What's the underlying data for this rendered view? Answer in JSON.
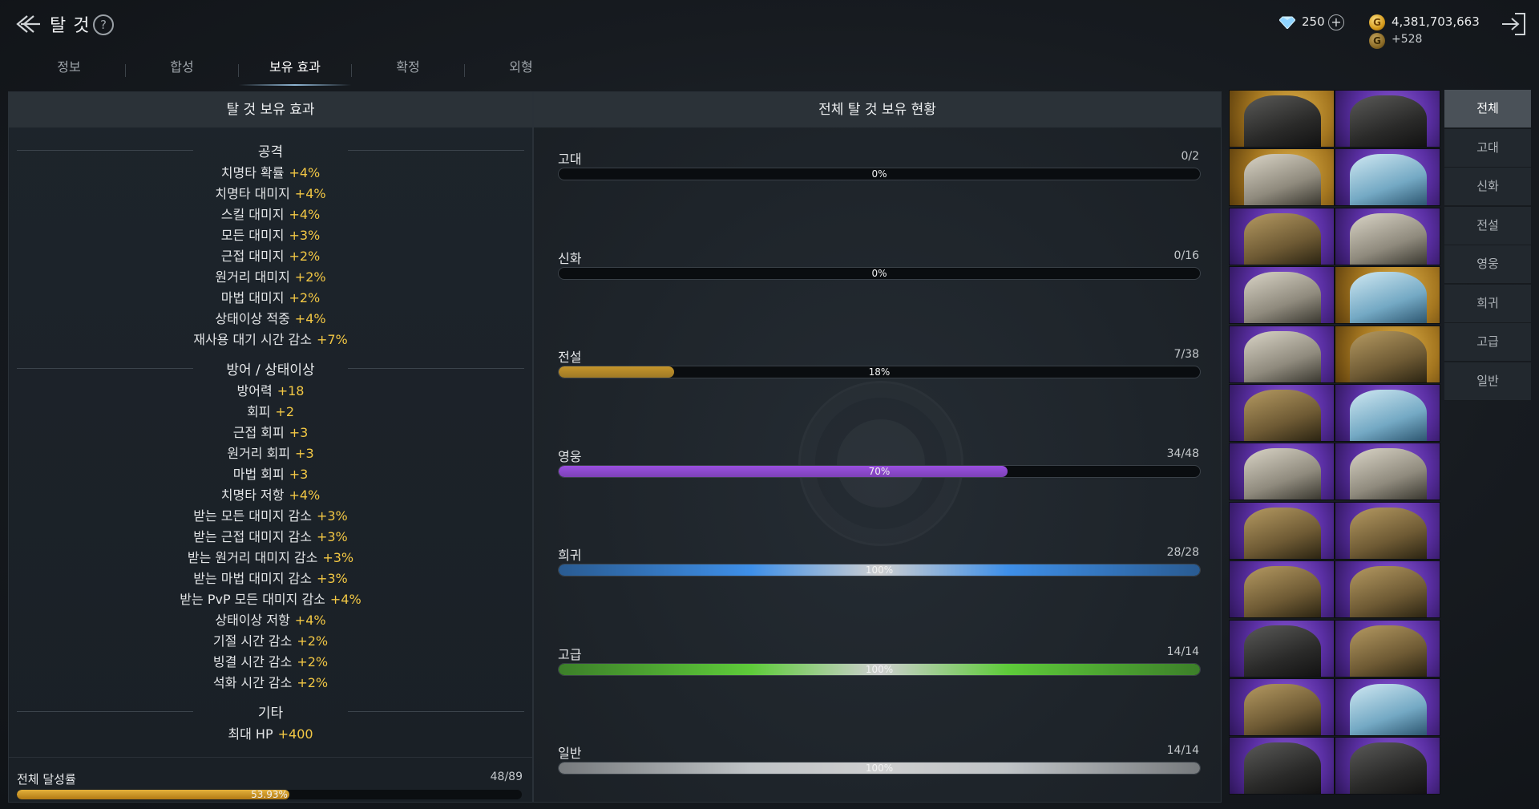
{
  "header": {
    "title": "탈 것",
    "help_icon": "?"
  },
  "currency": {
    "gems": "250",
    "gold": "4,381,703,663",
    "gold_income": "+528",
    "gold_symbol": "G"
  },
  "tabs": [
    {
      "label": "정보"
    },
    {
      "label": "합성"
    },
    {
      "label": "보유 효과"
    },
    {
      "label": "확정"
    },
    {
      "label": "외형"
    }
  ],
  "active_tab": "보유 효과",
  "left_panel": {
    "title": "탈 것 보유 효과",
    "sections": [
      {
        "title": "공격",
        "stats": [
          {
            "name": "치명타 확률",
            "value": "+4%"
          },
          {
            "name": "치명타 대미지",
            "value": "+4%"
          },
          {
            "name": "스킬 대미지",
            "value": "+4%"
          },
          {
            "name": "모든 대미지",
            "value": "+3%"
          },
          {
            "name": "근접 대미지",
            "value": "+2%"
          },
          {
            "name": "원거리 대미지",
            "value": "+2%"
          },
          {
            "name": "마법 대미지",
            "value": "+2%"
          },
          {
            "name": "상태이상 적중",
            "value": "+4%"
          },
          {
            "name": "재사용 대기 시간 감소",
            "value": "+7%"
          }
        ]
      },
      {
        "title": "방어 / 상태이상",
        "stats": [
          {
            "name": "방어력",
            "value": "+18"
          },
          {
            "name": "회피",
            "value": "+2"
          },
          {
            "name": "근접 회피",
            "value": "+3"
          },
          {
            "name": "원거리 회피",
            "value": "+3"
          },
          {
            "name": "마법 회피",
            "value": "+3"
          },
          {
            "name": "치명타 저항",
            "value": "+4%"
          },
          {
            "name": "받는 모든 대미지 감소",
            "value": "+3%"
          },
          {
            "name": "받는 근접 대미지 감소",
            "value": "+3%"
          },
          {
            "name": "받는 원거리 대미지 감소",
            "value": "+3%"
          },
          {
            "name": "받는 마법 대미지 감소",
            "value": "+3%"
          },
          {
            "name": "받는 PvP 모든 대미지 감소",
            "value": "+4%"
          },
          {
            "name": "상태이상 저항",
            "value": "+4%"
          },
          {
            "name": "기절 시간 감소",
            "value": "+2%"
          },
          {
            "name": "빙결 시간 감소",
            "value": "+2%"
          },
          {
            "name": "석화 시간 감소",
            "value": "+2%"
          }
        ]
      },
      {
        "title": "기타",
        "stats": [
          {
            "name": "최대 HP",
            "value": "+400"
          }
        ]
      }
    ],
    "total": {
      "label": "전체 달성률",
      "count": "48/89",
      "percent_text": "53.93%",
      "fraction": 0.5393
    }
  },
  "middle_panel": {
    "title": "전체 탈 것 보유 현황",
    "grades": [
      {
        "name": "고대",
        "count": "0/2",
        "percent_text": "0%",
        "fraction": 0.0,
        "color": "#c9a13a"
      },
      {
        "name": "신화",
        "count": "0/16",
        "percent_text": "0%",
        "fraction": 0.0,
        "color": "#d14848"
      },
      {
        "name": "전설",
        "count": "7/38",
        "percent_text": "18%",
        "fraction": 0.18,
        "color": "#c4952b"
      },
      {
        "name": "영웅",
        "count": "34/48",
        "percent_text": "70%",
        "fraction": 0.7,
        "color": "#9a4fe0"
      },
      {
        "name": "희귀",
        "count": "28/28",
        "percent_text": "100%",
        "fraction": 1.0,
        "color": "#3e8fe8"
      },
      {
        "name": "고급",
        "count": "14/14",
        "percent_text": "100%",
        "fraction": 1.0,
        "color": "#5ecb3a"
      },
      {
        "name": "일반",
        "count": "14/14",
        "percent_text": "100%",
        "fraction": 1.0,
        "color": "#bfc3c6"
      }
    ]
  },
  "portraits": [
    {
      "name": "dark-horse-mount",
      "rarity": "gold",
      "tone": "dark"
    },
    {
      "name": "crystal-dragon-mount",
      "rarity": "purple",
      "tone": "dark"
    },
    {
      "name": "bone-drake-mount",
      "rarity": "gold",
      "tone": "light"
    },
    {
      "name": "ice-beast-mount",
      "rarity": "purple",
      "tone": "teal"
    },
    {
      "name": "armored-wolf-mount",
      "rarity": "purple",
      "tone": "bronze"
    },
    {
      "name": "sea-serpent-mount",
      "rarity": "purple",
      "tone": "light"
    },
    {
      "name": "white-lion-mount",
      "rarity": "purple",
      "tone": "light"
    },
    {
      "name": "armored-boar-mount",
      "rarity": "gold",
      "tone": "teal"
    },
    {
      "name": "spider-beast-mount",
      "rarity": "purple",
      "tone": "light"
    },
    {
      "name": "golden-drake-mount",
      "rarity": "gold",
      "tone": "bronze"
    },
    {
      "name": "war-bear-mount",
      "rarity": "purple",
      "tone": "bronze"
    },
    {
      "name": "horned-dragon-mount",
      "rarity": "purple",
      "tone": "teal"
    },
    {
      "name": "ram-mount",
      "rarity": "purple",
      "tone": "light"
    },
    {
      "name": "griffin-mount",
      "rarity": "purple",
      "tone": "light"
    },
    {
      "name": "armored-steed-mount",
      "rarity": "purple",
      "tone": "bronze"
    },
    {
      "name": "golden-wyvern-mount",
      "rarity": "purple",
      "tone": "bronze"
    },
    {
      "name": "plated-rhino-mount",
      "rarity": "purple",
      "tone": "bronze"
    },
    {
      "name": "tusked-beast-mount",
      "rarity": "purple",
      "tone": "bronze"
    },
    {
      "name": "shadow-raptor-mount",
      "rarity": "purple",
      "tone": "dark"
    },
    {
      "name": "crimson-drake-mount",
      "rarity": "purple",
      "tone": "bronze"
    },
    {
      "name": "bronze-lion-mount",
      "rarity": "purple",
      "tone": "bronze"
    },
    {
      "name": "storm-eagle-mount",
      "rarity": "purple",
      "tone": "teal"
    },
    {
      "name": "black-knight-mount",
      "rarity": "purple",
      "tone": "dark"
    },
    {
      "name": "red-eye-dragon-mount",
      "rarity": "purple",
      "tone": "dark"
    }
  ],
  "filter_menu": {
    "items": [
      "전체",
      "고대",
      "신화",
      "전설",
      "영웅",
      "희귀",
      "고급",
      "일반"
    ],
    "active": "전체"
  },
  "icons": {
    "back": "back-arrow-icon",
    "help": "help-icon",
    "gem": "diamond-icon",
    "plus": "plus-icon",
    "gold": "gold-coin-icon",
    "exit": "exit-icon"
  }
}
